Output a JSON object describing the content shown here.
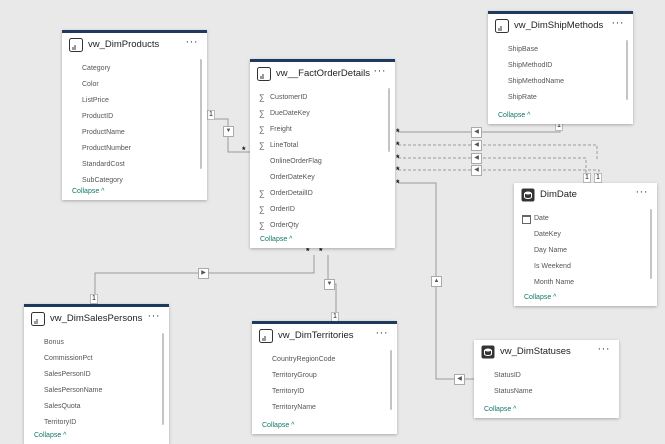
{
  "common": {
    "collapse_label": "Collapse ^",
    "more_label": "···"
  },
  "relationship_marks": {
    "many": "*",
    "one": "1"
  },
  "tables": {
    "products": {
      "title": "vw_DimProducts",
      "fields": [
        "Category",
        "Color",
        "ListPrice",
        "ProductID",
        "ProductName",
        "ProductNumber",
        "StandardCost",
        "SubCategory"
      ]
    },
    "fact": {
      "title": "vw__FactOrderDetails",
      "fields": [
        {
          "name": "CustomerID",
          "sigma": true
        },
        {
          "name": "DueDateKey",
          "sigma": true
        },
        {
          "name": "Freight",
          "sigma": true
        },
        {
          "name": "LineTotal",
          "sigma": true
        },
        {
          "name": "OnlineOrderFlag",
          "sigma": false
        },
        {
          "name": "OrderDateKey",
          "sigma": false
        },
        {
          "name": "OrderDetailID",
          "sigma": true
        },
        {
          "name": "OrderID",
          "sigma": true
        },
        {
          "name": "OrderQty",
          "sigma": true
        }
      ]
    },
    "shipmethods": {
      "title": "vw_DimShipMethods",
      "fields": [
        "ShipBase",
        "ShipMethodID",
        "ShipMethodName",
        "ShipRate"
      ]
    },
    "date": {
      "title": "DimDate",
      "fields": [
        {
          "name": "Date",
          "calendar": true
        },
        {
          "name": "DateKey",
          "calendar": false
        },
        {
          "name": "Day Name",
          "calendar": false
        },
        {
          "name": "Is Weekend",
          "calendar": false
        },
        {
          "name": "Month Name",
          "calendar": false
        }
      ]
    },
    "salespersons": {
      "title": "vw_DimSalesPersons",
      "fields": [
        "Bonus",
        "CommissionPct",
        "SalesPersonID",
        "SalesPersonName",
        "SalesQuota",
        "TerritoryID"
      ]
    },
    "territories": {
      "title": "vw_DimTerritories",
      "fields": [
        "CountryRegionCode",
        "TerritoryGroup",
        "TerritoryID",
        "TerritoryName"
      ]
    },
    "statuses": {
      "title": "vw_DimStatuses",
      "fields": [
        "StatusID",
        "StatusName"
      ]
    }
  }
}
